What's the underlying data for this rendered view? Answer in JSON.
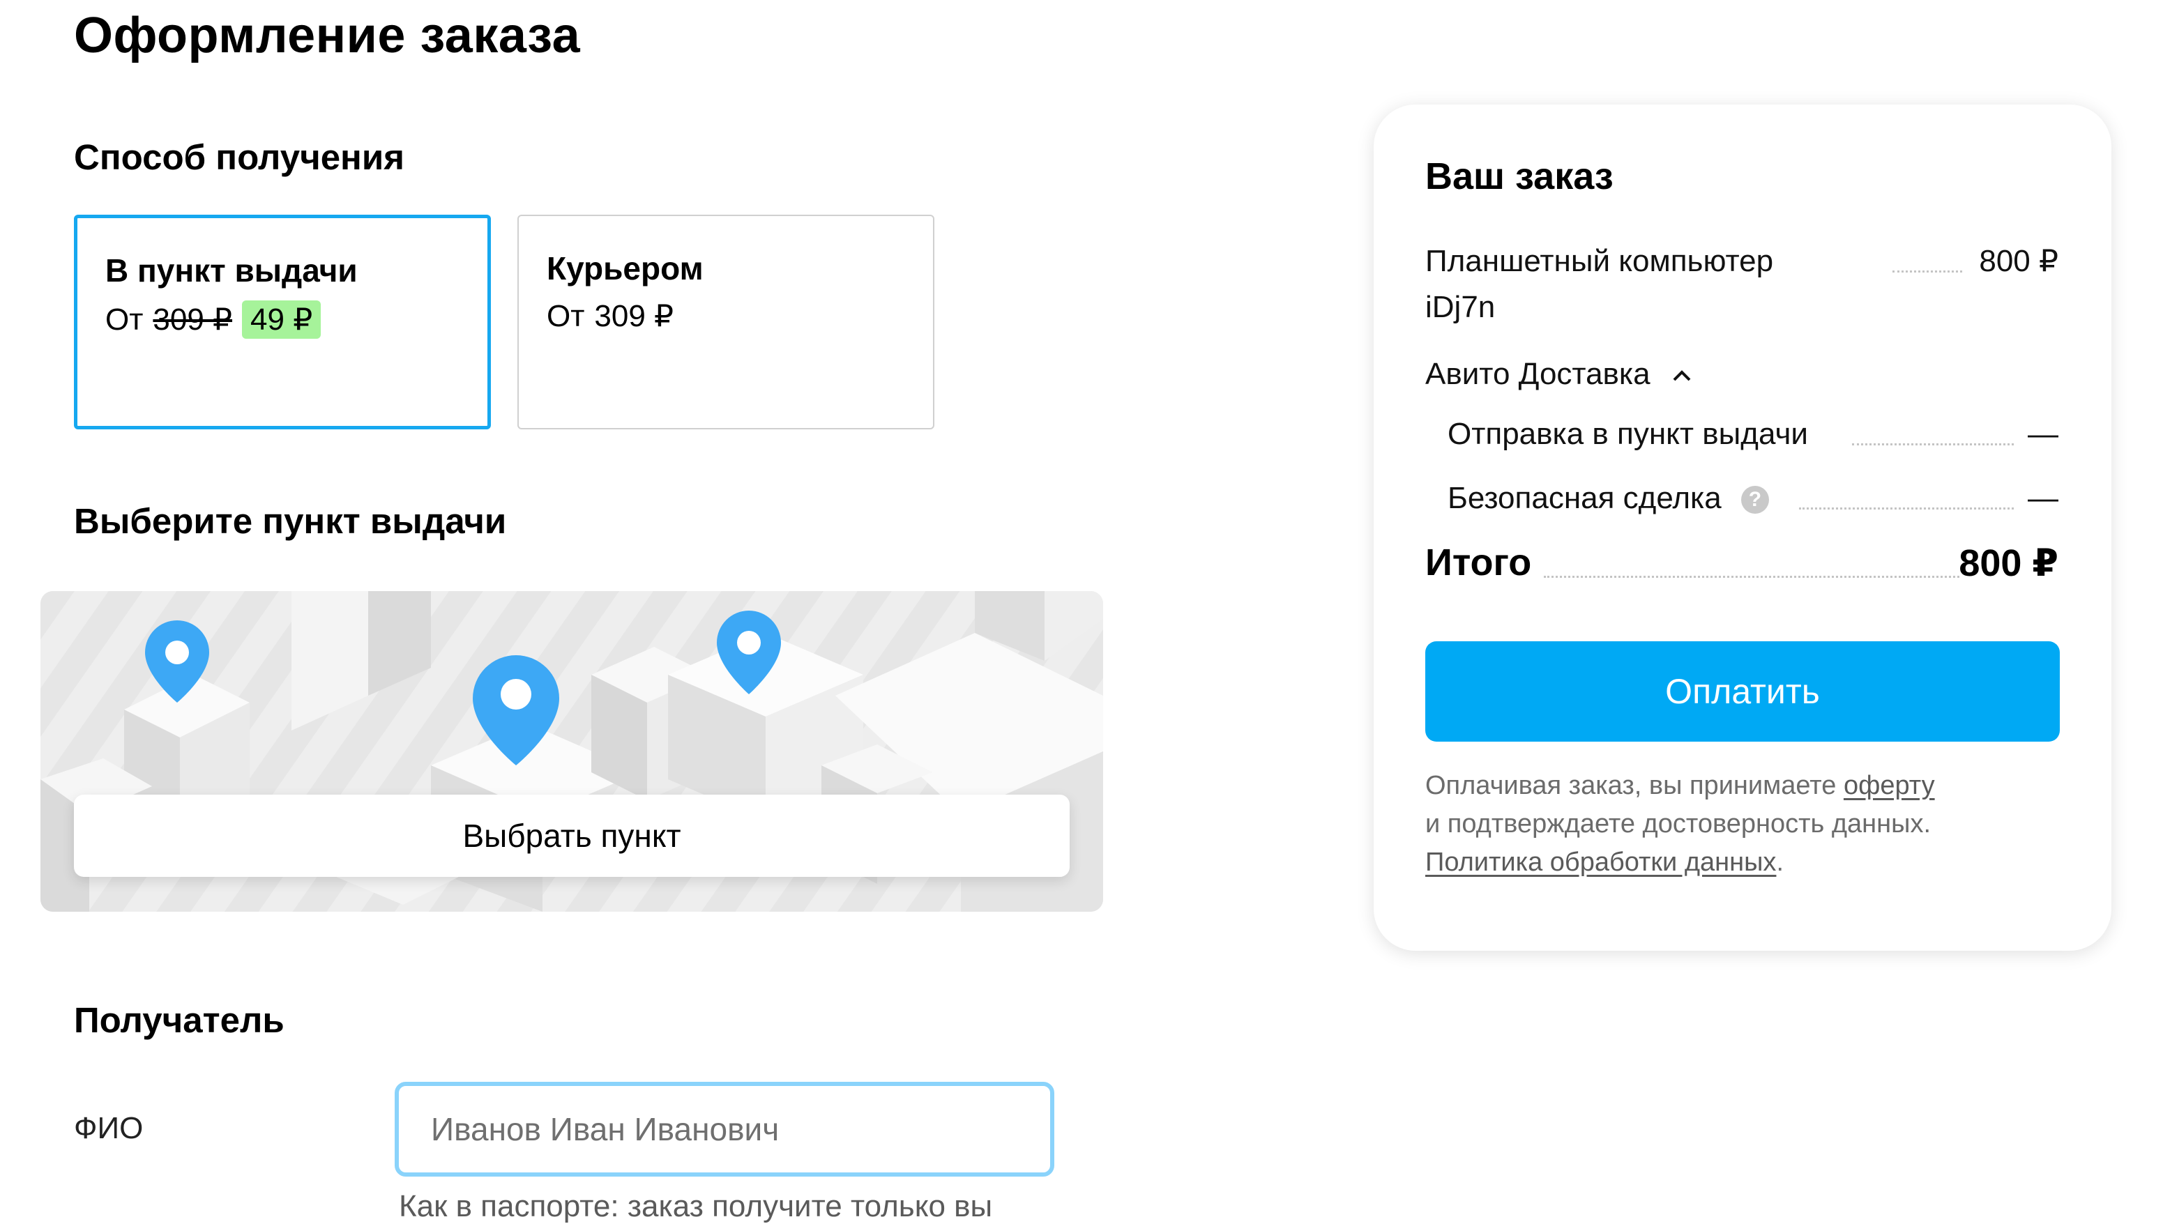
{
  "page": {
    "title": "Оформление заказа"
  },
  "delivery": {
    "heading": "Способ получения",
    "options": [
      {
        "title": "В пункт выдачи",
        "prefix": "От",
        "old_price": "309 ₽",
        "new_price": "49 ₽",
        "selected": true
      },
      {
        "title": "Курьером",
        "prefix": "От",
        "price": "309 ₽",
        "selected": false
      }
    ]
  },
  "pickup": {
    "heading": "Выберите пункт выдачи",
    "button_label": "Выбрать пункт",
    "pin_color": "#3da8f5"
  },
  "recipient": {
    "heading": "Получатель",
    "fio_label": "ФИО",
    "fio_placeholder": "Иванов Иван Иванович",
    "fio_value": "",
    "fio_hint": "Как в паспорте: заказ получите только вы"
  },
  "order": {
    "heading": "Ваш заказ",
    "item_name_line1": "Планшетный компьютер",
    "item_name_line2": "iDj7n",
    "item_price": "800 ₽",
    "delivery_group_label": "Авито Доставка",
    "delivery_lines": [
      {
        "label": "Отправка в пункт выдачи",
        "value": "—"
      },
      {
        "label": "Безопасная сделка",
        "value": "—",
        "help_icon": "?"
      }
    ],
    "total_label": "Итого",
    "total_value": "800 ₽",
    "pay_label": "Оплатить",
    "legal": {
      "text1": "Оплачивая заказ, вы принимаете ",
      "offer_link": "оферту",
      "text2": "и подтверждаете достоверность данных.",
      "policy_link": "Политика обработки данных",
      "text3": "."
    }
  },
  "colors": {
    "accent": "#00a9f4",
    "selected_border": "#16a8f0",
    "discount_badge": "#a6f39a",
    "input_focus": "#8ad3fb"
  }
}
